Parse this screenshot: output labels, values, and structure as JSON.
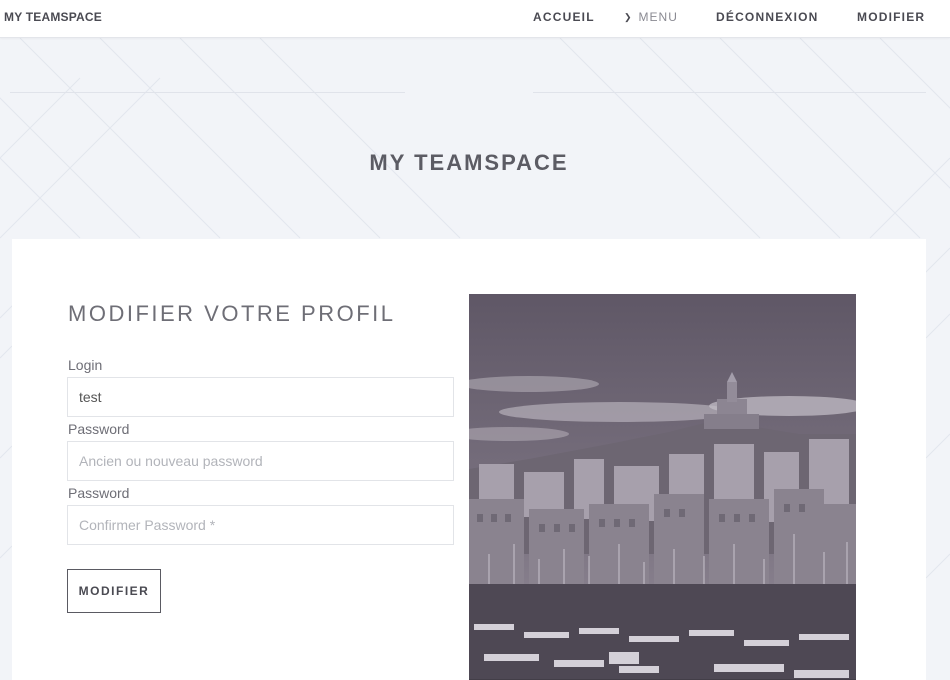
{
  "nav": {
    "brand": "MY TEAMSPACE",
    "accueil": "ACCUEIL",
    "menu": "MENU",
    "deconnexion": "DÉCONNEXION",
    "modifier": "MODIFIER"
  },
  "page": {
    "title": "MY TEAMSPACE"
  },
  "form": {
    "title": "MODIFIER VOTRE PROFIL",
    "login_label": "Login",
    "login_value": "test",
    "password_label": "Password",
    "password_placeholder": "Ancien ou nouveau password",
    "confirm_label": "Password",
    "confirm_placeholder": "Confirmer Password *",
    "submit_label": "MODIFIER"
  },
  "image": {
    "icon": "city-harbor-photo"
  },
  "colors": {
    "background": "#f2f4f8",
    "card": "#ffffff",
    "text": "#4a4a52"
  }
}
